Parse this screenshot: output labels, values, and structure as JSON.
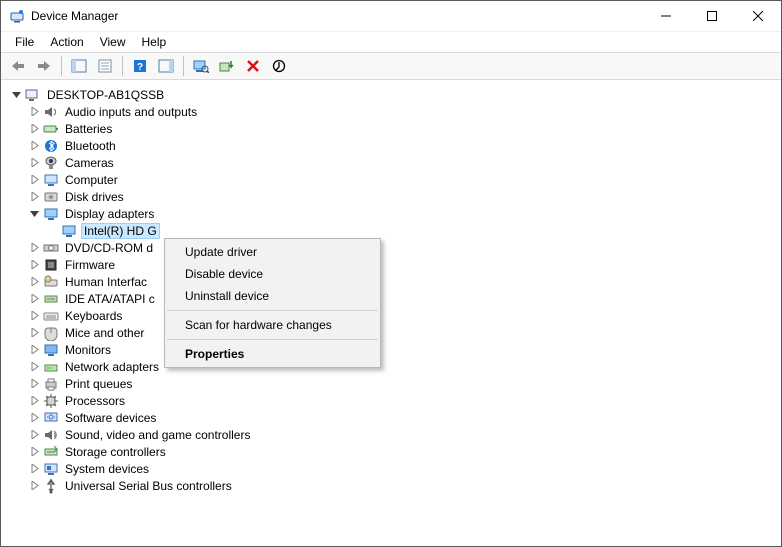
{
  "window": {
    "title": "Device Manager"
  },
  "menu": {
    "file": "File",
    "action": "Action",
    "view": "View",
    "help": "Help"
  },
  "root": {
    "name": "DESKTOP-AB1QSSB"
  },
  "categories": {
    "audio": "Audio inputs and outputs",
    "batteries": "Batteries",
    "bluetooth": "Bluetooth",
    "cameras": "Cameras",
    "computer": "Computer",
    "disk": "Disk drives",
    "display": "Display adapters",
    "display_child": "Intel(R) HD G",
    "dvd": "DVD/CD-ROM d",
    "firmware": "Firmware",
    "hid": "Human Interfac",
    "ide": "IDE ATA/ATAPI c",
    "keyboards": "Keyboards",
    "mice": "Mice and other",
    "monitors": "Monitors",
    "network": "Network adapters",
    "printq": "Print queues",
    "processors": "Processors",
    "softdev": "Software devices",
    "sound": "Sound, video and game controllers",
    "storage": "Storage controllers",
    "sysdev": "System devices",
    "usb": "Universal Serial Bus controllers"
  },
  "context": {
    "update": "Update driver",
    "disable": "Disable device",
    "uninstall": "Uninstall device",
    "scan": "Scan for hardware changes",
    "properties": "Properties"
  }
}
